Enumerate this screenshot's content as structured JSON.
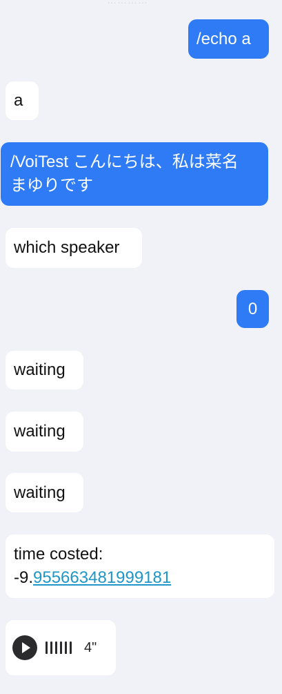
{
  "header": {
    "ghost_text": "…………"
  },
  "messages": [
    {
      "id": "m1",
      "direction": "out",
      "text": "/echo a"
    },
    {
      "id": "m2",
      "direction": "in",
      "text": "a"
    },
    {
      "id": "m3",
      "direction": "out",
      "text": "/VoiTest こんにちは、私は菜名まゆりです"
    },
    {
      "id": "m4",
      "direction": "in",
      "text": "which speaker"
    },
    {
      "id": "m5",
      "direction": "out",
      "text": "0"
    },
    {
      "id": "m6",
      "direction": "in",
      "text": "waiting"
    },
    {
      "id": "m7",
      "direction": "in",
      "text": "waiting"
    },
    {
      "id": "m8",
      "direction": "in",
      "text": "waiting"
    },
    {
      "id": "m9",
      "direction": "in",
      "label": "time costed:",
      "prefix": "-9.",
      "link_text": "955663481999181"
    },
    {
      "id": "m10",
      "direction": "in",
      "type": "voice",
      "duration": "4\""
    }
  ],
  "colors": {
    "background": "#f1f2f7",
    "outgoing": "#2f7bf6",
    "incoming": "#ffffff",
    "link": "#1f95c8"
  },
  "icons": {
    "play": "play-icon",
    "waveform": "waveform-icon"
  }
}
